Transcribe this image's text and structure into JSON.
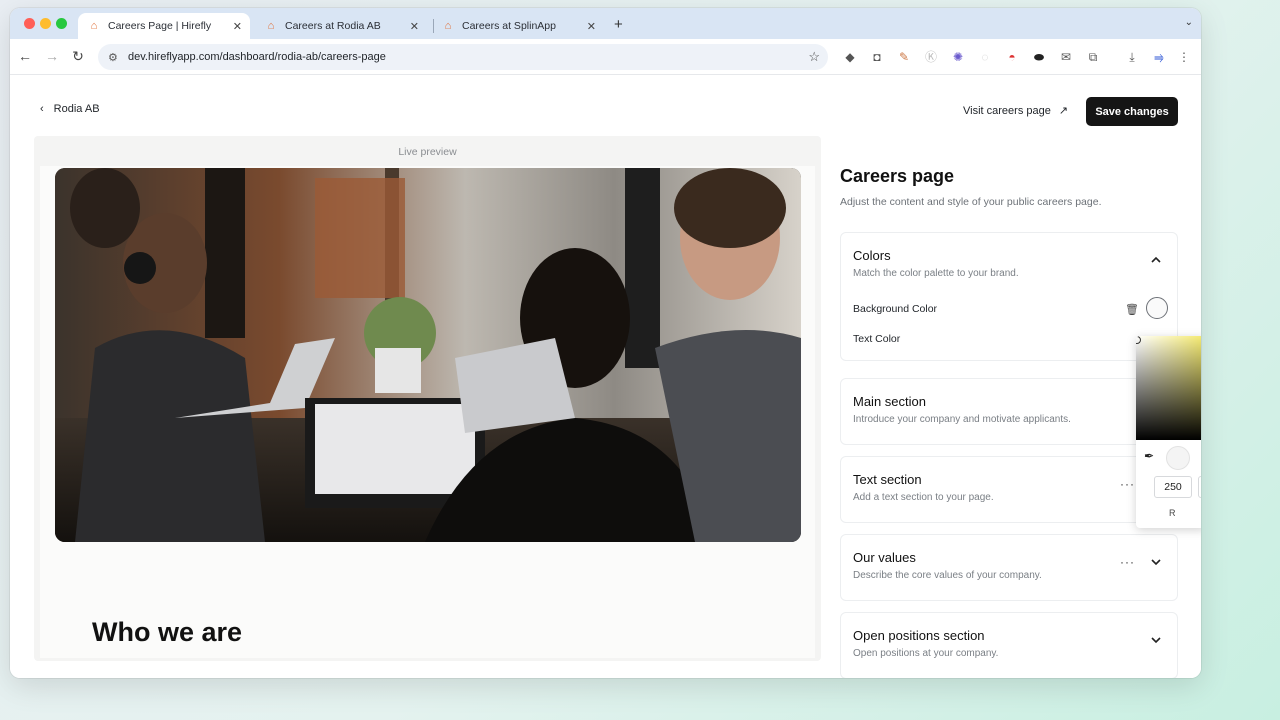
{
  "browser": {
    "tabs": [
      {
        "title": "Careers Page | Hirefly",
        "active": true
      },
      {
        "title": "Careers at Rodia AB",
        "active": false
      },
      {
        "title": "Careers at SplinApp",
        "active": false
      }
    ],
    "url": "dev.hireflyapp.com/dashboard/rodia-ab/careers-page"
  },
  "header": {
    "back_label": "Rodia AB",
    "visit_label": "Visit careers page",
    "save_label": "Save changes"
  },
  "preview": {
    "label": "Live preview",
    "heading": "Who we are"
  },
  "sidebar": {
    "title": "Careers page",
    "subtitle": "Adjust the content and style of your public careers page.",
    "sections": [
      {
        "title": "Colors",
        "subtitle": "Match the color palette to your brand.",
        "expanded": true
      },
      {
        "title": "Main section",
        "subtitle": "Introduce your company and motivate applicants."
      },
      {
        "title": "Text section",
        "subtitle": "Add a text section to your page."
      },
      {
        "title": "Our values",
        "subtitle": "Describe the core values of your company."
      },
      {
        "title": "Open positions section",
        "subtitle": "Open positions at your company."
      }
    ],
    "colors": {
      "background_label": "Background Color",
      "text_label": "Text Color"
    }
  },
  "picker": {
    "channel_value": "250",
    "channel_label": "R"
  }
}
